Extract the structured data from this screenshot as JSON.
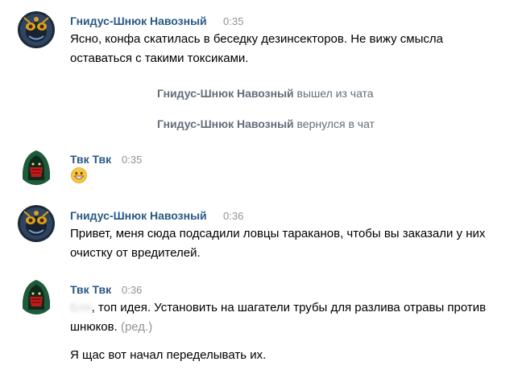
{
  "messages": [
    {
      "author": "Гнидус-Шнюк Навозный",
      "time": "0:35",
      "avatar_icon": "bug-avatar",
      "text": "Ясно, конфа скатилась в беседку дезинсекторов. Не вижу смысла оставаться с такими токсиками."
    },
    {
      "author": "Твк Твк",
      "time": "0:35",
      "avatar_icon": "hooded-figure-avatar",
      "emoji": "grinning-emoji"
    },
    {
      "author": "Гнидус-Шнюк Навозный",
      "time": "0:36",
      "avatar_icon": "bug-avatar",
      "text": "Привет, меня сюда подсадили ловцы тараканов, чтобы вы заказали у них очистку от вредителей."
    },
    {
      "author": "Твк Твк",
      "time": "0:36",
      "avatar_icon": "hooded-figure-avatar",
      "text_censored_word": "Бля",
      "text_rest": ", топ идея. Установить на шагатели трубы для разлива отравы против шнюков.",
      "edited_label": "(ред.)",
      "text2": "Я щас вот начал переделывать их."
    }
  ],
  "service": [
    {
      "who": "Гнидус-Шнюк Навозный",
      "action": "вышел из чата"
    },
    {
      "who": "Гнидус-Шнюк Навозный",
      "action": "вернулся в чат"
    }
  ],
  "colors": {
    "author": "#2a5885",
    "time": "#939393",
    "service": "#626d7a"
  }
}
